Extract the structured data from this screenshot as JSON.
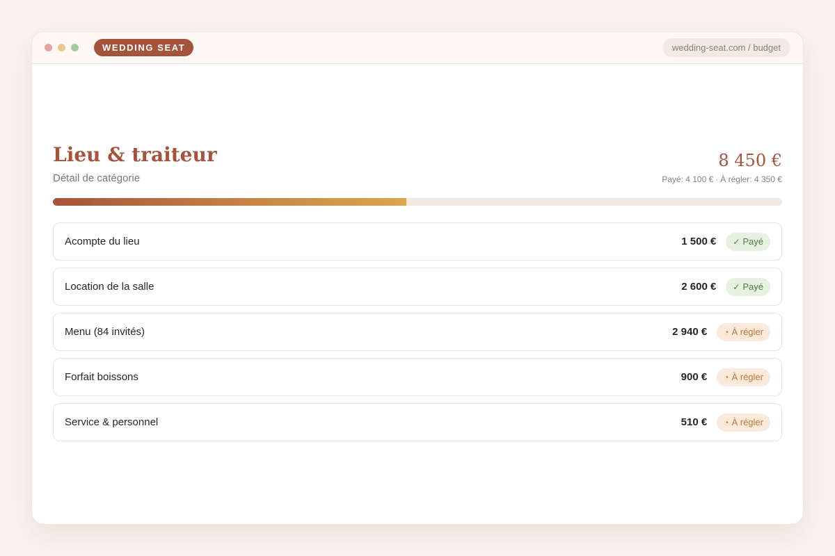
{
  "app": {
    "brand": "WEDDING SEAT",
    "url": "wedding-seat.com / budget"
  },
  "category": {
    "title": "Lieu & traiteur",
    "subtitle": "Détail de catégorie",
    "total": "8 450 €",
    "paid_summary": "Payé: 4 100 €",
    "due_summary": "À régler: 4 350 €",
    "separator": "·",
    "progress_fraction": 0.4852
  },
  "colors": {
    "accent": "#a6533b",
    "progress_end": "#dca54e",
    "paid": "#4d7a43",
    "due": "#b9772e"
  },
  "items": [
    {
      "label": "Acompte du lieu",
      "amount": "1 500 €",
      "status": "paid",
      "status_label": "Payé",
      "status_icon": "✓"
    },
    {
      "label": "Location de la salle",
      "amount": "2 600 €",
      "status": "paid",
      "status_label": "Payé",
      "status_icon": "✓"
    },
    {
      "label": "Menu (84 invités)",
      "amount": "2 940 €",
      "status": "due",
      "status_label": "À régler",
      "status_icon": "◔"
    },
    {
      "label": "Forfait boissons",
      "amount": "900 €",
      "status": "due",
      "status_label": "À régler",
      "status_icon": "◔"
    },
    {
      "label": "Service & personnel",
      "amount": "510 €",
      "status": "due",
      "status_label": "À régler",
      "status_icon": "◔"
    }
  ]
}
